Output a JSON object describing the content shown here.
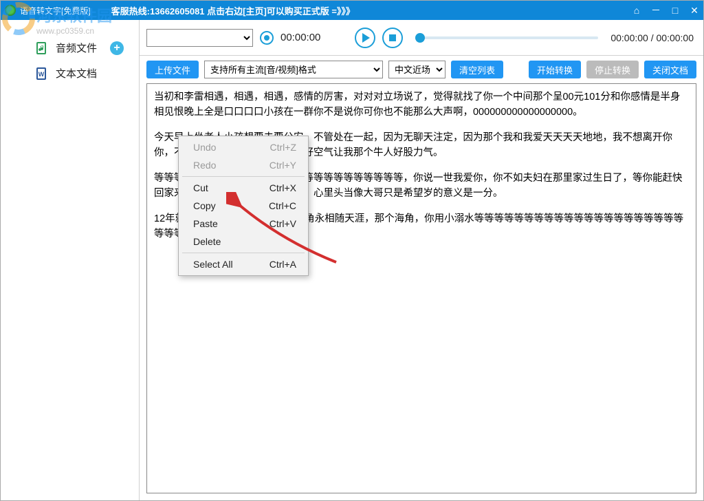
{
  "titlebar": {
    "title": "语音转文字[免费版]",
    "hotline": "客服热线:13662605081  点击右边[主页]可以购买正式版 =》》》"
  },
  "sidebar": {
    "audio": "音频文件",
    "doc": "文本文档"
  },
  "player": {
    "rec_time": "00:00:00",
    "duration": "00:00:00 / 00:00:00"
  },
  "toolbar": {
    "upload": "上传文件",
    "format_sel": "支持所有主流[音/视频]格式",
    "lang_sel": "中文近场",
    "clear": "清空列表",
    "start": "开始转换",
    "stop": "停止转换",
    "close": "关闭文档"
  },
  "text": {
    "p1": "当初和李雷相遇，相遇，相遇，感情的厉害，对对对立场说了，觉得就找了你一个中间那个呈00元101分和你感情是半身相见恨晚上全是口口口口小孩在一群你不是说你可你也不能那么大声啊，000000000000000000。",
    "p2a": "今天早上坐老人小孩想要去要公安",
    "p2b": "，不管处在一起，因为无聊天注定，因为那个我和我爱天天天天地地，我不想离开你你",
    "p2c": "，不知何事来想剪，让我流泪，好空气让我那个牛人好股力气。",
    "p3a": "等等等",
    "p3b": "等等等等等等等等等等等等等等等等等等等等等等，你说一世我爱你，你不如夫妇在那里",
    "p3c": "家过生日了，等你能赶快回家来做事，你你你你你看我视频，心里头当像大哥只是希望",
    "p3d": "岁的意义是一分。",
    "p4a": "12年就",
    "p4b": "无论怎样，等着你，天涯海角永相随天涯，那个海角，你用小溺水等等等等等等等等等等",
    "p4c": "等等等等等等等等等等等等等等等等等对对对。"
  },
  "ctx": {
    "undo": "Undo",
    "undo_k": "Ctrl+Z",
    "redo": "Redo",
    "redo_k": "Ctrl+Y",
    "cut": "Cut",
    "cut_k": "Ctrl+X",
    "copy": "Copy",
    "copy_k": "Ctrl+C",
    "paste": "Paste",
    "paste_k": "Ctrl+V",
    "delete": "Delete",
    "selall": "Select All",
    "selall_k": "Ctrl+A"
  },
  "watermark": "河东软件园",
  "watermark_url": "www.pc0359.cn"
}
